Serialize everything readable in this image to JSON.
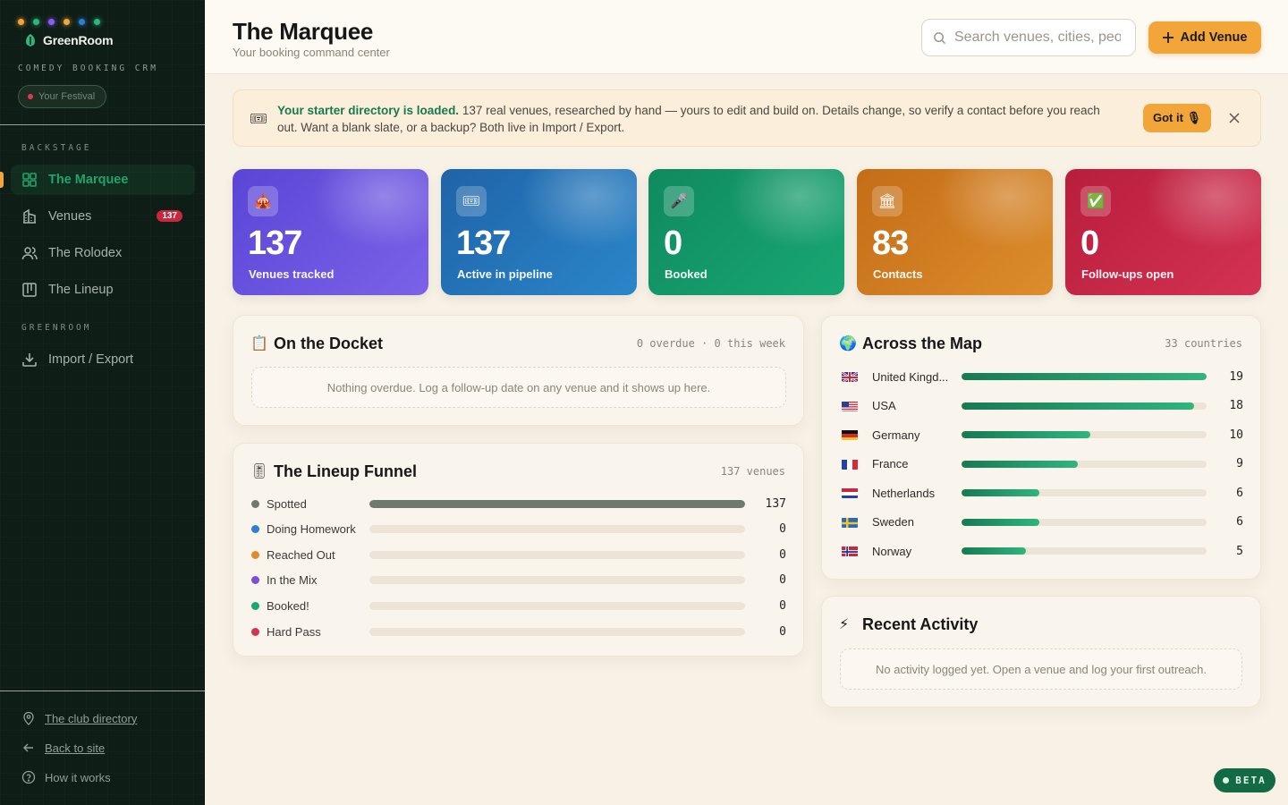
{
  "brand": {
    "name": "GreenRoom",
    "subtitle": "COMEDY BOOKING CRM",
    "festival_label": "Your Festival",
    "bulb_colors": [
      "#f0a63a",
      "#2fb57e",
      "#8b5cf6",
      "#f0a63a",
      "#2d7fd3",
      "#2fb57e"
    ]
  },
  "sidebar": {
    "section_backstage": "BACKSTAGE",
    "section_greenroom": "GREENROOM",
    "items": [
      {
        "label": "The Marquee",
        "icon": "dashboard-icon",
        "active": true
      },
      {
        "label": "Venues",
        "icon": "building-icon",
        "badge": "137"
      },
      {
        "label": "The Rolodex",
        "icon": "people-icon"
      },
      {
        "label": "The Lineup",
        "icon": "kanban-icon"
      }
    ],
    "greenroom_items": [
      {
        "label": "Import / Export",
        "icon": "download-icon"
      }
    ],
    "footer": {
      "club_directory": "The club directory",
      "back_to_site": "Back to site",
      "how_it_works": "How it works"
    }
  },
  "header": {
    "title": "The Marquee",
    "subtitle": "Your booking command center",
    "search_placeholder": "Search venues, cities, people",
    "add_button": "Add Venue"
  },
  "banner": {
    "bold": "Your starter directory is loaded.",
    "text": " 137 real venues, researched by hand — yours to edit and build on. Details change, so verify a contact before you reach out. Want a blank slate, or a backup? Both live in Import / Export.",
    "button": "Got it 🎙"
  },
  "stats": [
    {
      "value": "137",
      "label": "Venues tracked",
      "icon": "🎪",
      "gradient": [
        "#5a45d6",
        "#7b62e8"
      ]
    },
    {
      "value": "137",
      "label": "Active in pipeline",
      "icon": "🎟",
      "gradient": [
        "#1f63a8",
        "#2b86c9"
      ]
    },
    {
      "value": "0",
      "label": "Booked",
      "icon": "🎤",
      "gradient": [
        "#0f8a5f",
        "#19a774"
      ]
    },
    {
      "value": "83",
      "label": "Contacts",
      "icon": "🏛",
      "gradient": [
        "#c46d17",
        "#dc8d2c"
      ]
    },
    {
      "value": "0",
      "label": "Follow-ups open",
      "icon": "✅",
      "gradient": [
        "#b81e3b",
        "#d43253"
      ]
    }
  ],
  "docket": {
    "title": "On the Docket",
    "meta": "0 overdue · 0 this week",
    "empty": "Nothing overdue. Log a follow-up date on any venue and it shows up here."
  },
  "funnel": {
    "title": "The Lineup Funnel",
    "meta": "137 venues",
    "rows": [
      {
        "name": "Spotted",
        "count": "137",
        "fraction": 1.0,
        "color": "#6f7a6c"
      },
      {
        "name": "Doing Homework",
        "count": "0",
        "fraction": 0,
        "color": "#2d7fd3"
      },
      {
        "name": "Reached Out",
        "count": "0",
        "fraction": 0,
        "color": "#e08a2b"
      },
      {
        "name": "In the Mix",
        "count": "0",
        "fraction": 0,
        "color": "#7b4fd8"
      },
      {
        "name": "Booked!",
        "count": "0",
        "fraction": 0,
        "color": "#19a774"
      },
      {
        "name": "Hard Pass",
        "count": "0",
        "fraction": 0,
        "color": "#d43253"
      }
    ]
  },
  "map": {
    "title": "Across the Map",
    "meta": "33 countries",
    "rows": [
      {
        "name": "United Kingd...",
        "count": "19",
        "value": 19,
        "flag": "uk-flag-icon"
      },
      {
        "name": "USA",
        "count": "18",
        "value": 18,
        "flag": "us-flag-icon"
      },
      {
        "name": "Germany",
        "count": "10",
        "value": 10,
        "flag": "de-flag-icon"
      },
      {
        "name": "France",
        "count": "9",
        "value": 9,
        "flag": "fr-flag-icon"
      },
      {
        "name": "Netherlands",
        "count": "6",
        "value": 6,
        "flag": "nl-flag-icon"
      },
      {
        "name": "Sweden",
        "count": "6",
        "value": 6,
        "flag": "se-flag-icon"
      },
      {
        "name": "Norway",
        "count": "5",
        "value": 5,
        "flag": "no-flag-icon"
      }
    ]
  },
  "activity": {
    "title": "Recent Activity",
    "empty": "No activity logged yet. Open a venue and log your first outreach."
  },
  "beta": "BETA"
}
